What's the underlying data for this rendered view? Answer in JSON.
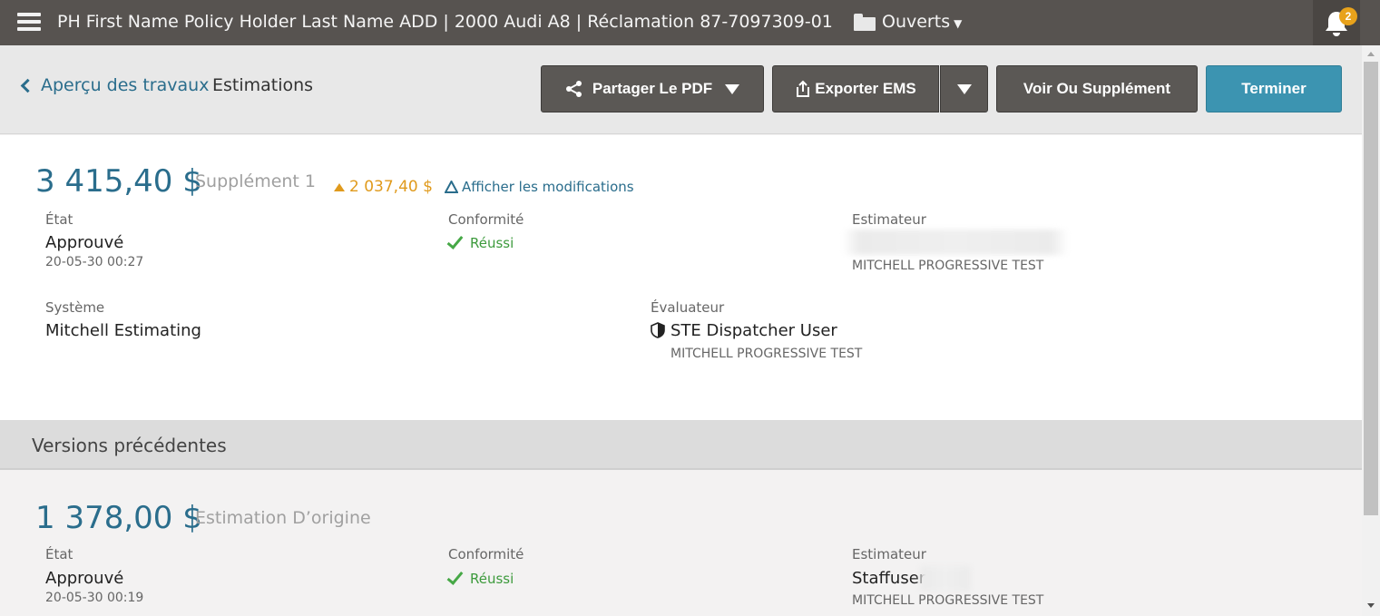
{
  "topbar": {
    "title": "PH First Name Policy Holder Last Name ADD | 2000 Audi A8 | Réclamation 87-7097309-01",
    "folder_label": "Ouverts",
    "notification_count": "2"
  },
  "breadcrumb": {
    "back_label": "Aperçu des travaux",
    "current_label": "Estimations"
  },
  "toolbar": {
    "share_label": "Partager Le PDF",
    "export_label": "Exporter EMS",
    "supplement_label": "Voir Ou Supplément",
    "finish_label": "Terminer",
    "finish_color": "#3c94b1"
  },
  "current_estimate": {
    "amount": "3 415,40 $",
    "type": "Supplément 1",
    "delta": "2 037,40 $",
    "changes_link": "Afficher les modifications",
    "state_label": "État",
    "state_value": "Approuvé",
    "state_date": "20-05-30 00:27",
    "compliance_label": "Conformité",
    "compliance_value": "Réussi",
    "estimator_label": "Estimateur",
    "estimator_company": "MITCHELL PROGRESSIVE TEST",
    "system_label": "Système",
    "system_value": "Mitchell Estimating",
    "appraiser_label": "Évaluateur",
    "appraiser_value": "STE Dispatcher User",
    "appraiser_company": "MITCHELL PROGRESSIVE TEST"
  },
  "previous_versions": {
    "title": "Versions précédentes",
    "items": [
      {
        "amount": "1 378,00 $",
        "type": "Estimation D’origine",
        "state_label": "État",
        "state_value": "Approuvé",
        "state_date": "20-05-30 00:19",
        "compliance_label": "Conformité",
        "compliance_value": "Réussi",
        "estimator_label": "Estimateur",
        "estimator_value": "Staffuser",
        "estimator_company": "MITCHELL PROGRESSIVE TEST"
      }
    ]
  },
  "icons": {
    "menu": "hamburger-menu-icon",
    "folder": "folder-icon",
    "bell": "bell-icon",
    "back": "chevron-left-icon",
    "share": "share-icon",
    "export": "export-icon",
    "delta_up": "triangle-up-icon",
    "changes": "delta-icon",
    "check": "checkmark-icon",
    "shield": "shield-icon"
  }
}
